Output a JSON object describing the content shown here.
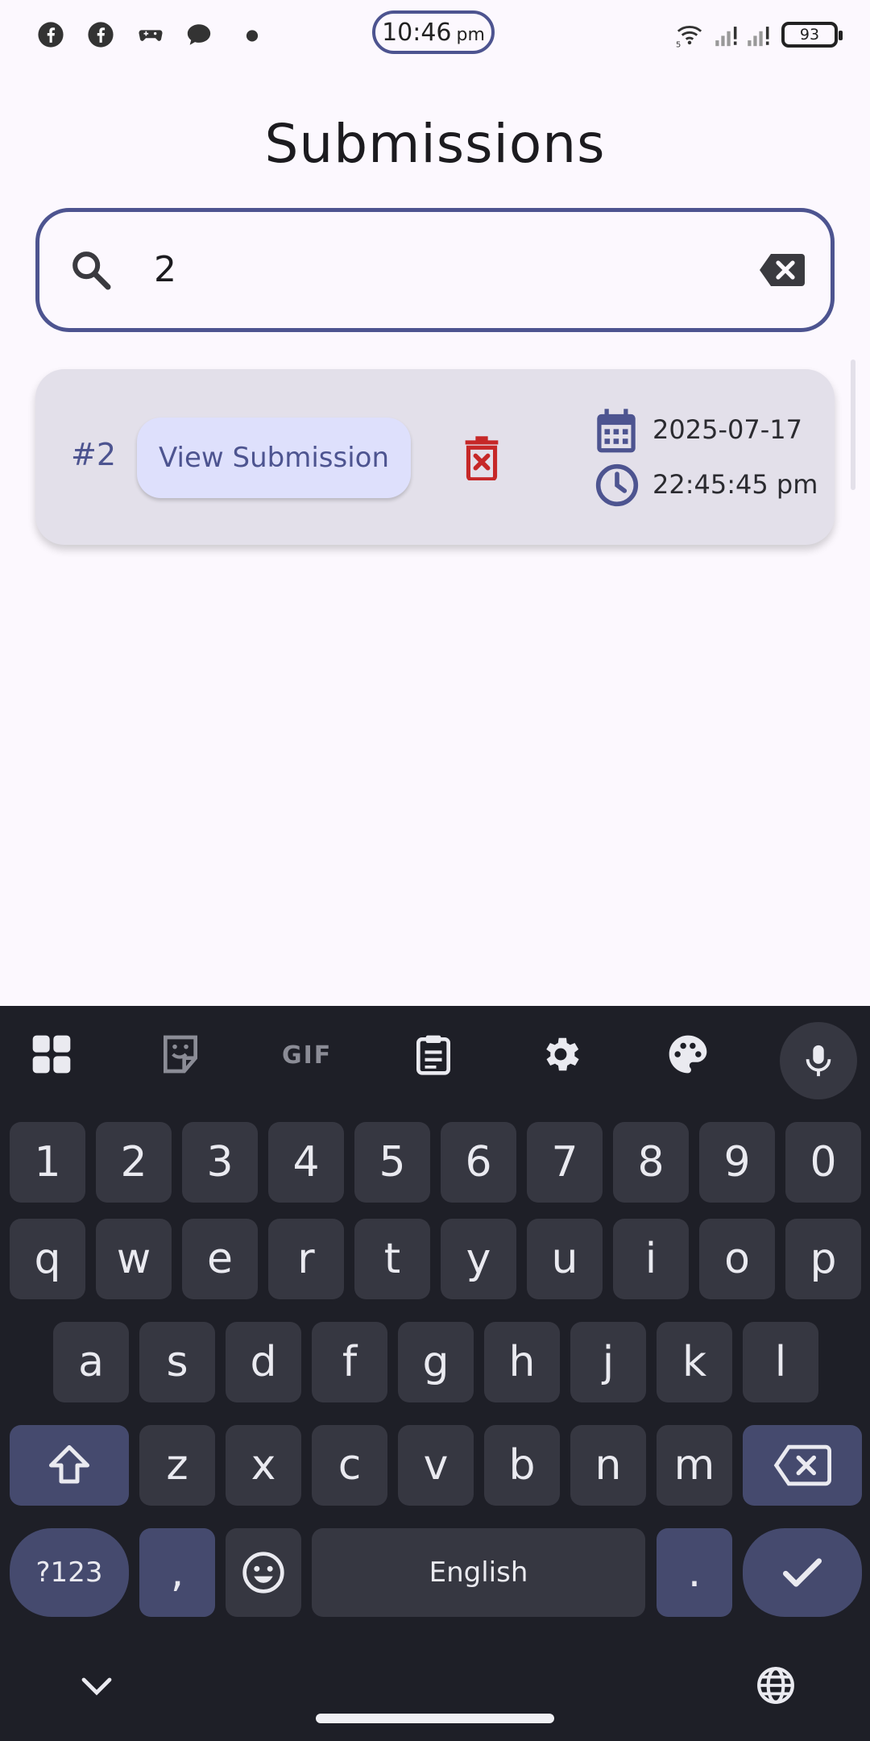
{
  "status_bar": {
    "time": "10:46",
    "ampm": "pm",
    "battery": "93",
    "network_label": "5"
  },
  "page": {
    "title": "Submissions"
  },
  "search": {
    "value": "2"
  },
  "submissions": [
    {
      "id": "#2",
      "action_label": "View Submission",
      "date": "2025-07-17",
      "time": "22:45:45 pm"
    }
  ],
  "keyboard": {
    "row1": [
      "1",
      "2",
      "3",
      "4",
      "5",
      "6",
      "7",
      "8",
      "9",
      "0"
    ],
    "row2": [
      "q",
      "w",
      "e",
      "r",
      "t",
      "y",
      "u",
      "i",
      "o",
      "p"
    ],
    "row3": [
      "a",
      "s",
      "d",
      "f",
      "g",
      "h",
      "j",
      "k",
      "l"
    ],
    "row4": [
      "z",
      "x",
      "c",
      "v",
      "b",
      "n",
      "m"
    ],
    "symbols_label": "?123",
    "comma": ",",
    "space_label": "English",
    "period": ".",
    "toolbar_gif": "GIF"
  },
  "colors": {
    "accent": "#4d5490",
    "card_bg": "#e3e0ea",
    "button_bg": "#dee0fc",
    "delete": "#c62828",
    "keyboard_bg": "#1e1f27"
  }
}
